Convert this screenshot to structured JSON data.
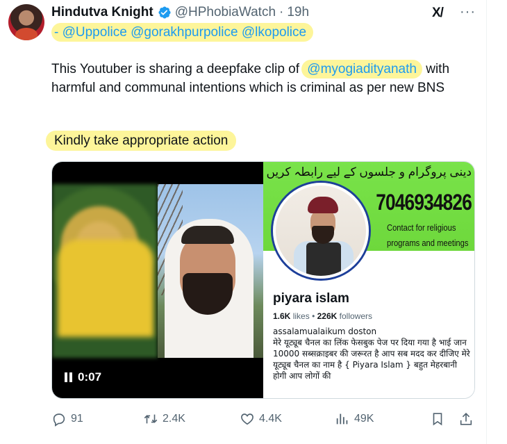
{
  "tweet": {
    "author_name": "Hindutva Knight",
    "handle": "@HPhobiaWatch",
    "separator": "·",
    "time": "19h",
    "grok_label": "X/",
    "more_label": "···",
    "mentions_line": "- @Uppolice @gorakhpurpolice @lkopolice",
    "body_part1": "This Youtuber is sharing a deepfake clip of ",
    "body_mention": "@myogiadityanath",
    "body_part2": " with harmful and communal intentions which is criminal as per new BNS",
    "action_line": "Kindly take appropriate action"
  },
  "media": {
    "video_time": "0:07",
    "profile": {
      "banner_urdu": "دینی پروگرام و جلسوں کے لیے رابطہ کریں",
      "banner_phone": "7046934826",
      "banner_contact": "Contact for religious programs and meetings",
      "name": "piyara islam",
      "likes_count": "1.6K",
      "likes_label": "likes",
      "followers_count": "226K",
      "followers_label": "followers",
      "bio_greeting": "assalamualaikum doston",
      "bio_text": "मेरे यूट्यूब चैनल का लिंक फेसबुक पेज पर दिया गया है भाई जान 10000 सब्सक्राइबर की जरूरत है आप सब मदद कर दीजिए मेरे यूट्यूब चैनल का नाम है { Piyara Islam } बहुत मेहरबानी होगी आप लोगों की"
    }
  },
  "actions": {
    "replies": "91",
    "reposts": "2.4K",
    "likes": "4.4K",
    "views": "49K"
  },
  "colors": {
    "accent": "#1d9bf0",
    "highlight": "#fdf59a",
    "banner_green": "#79e34a",
    "muted_text": "#536471"
  }
}
